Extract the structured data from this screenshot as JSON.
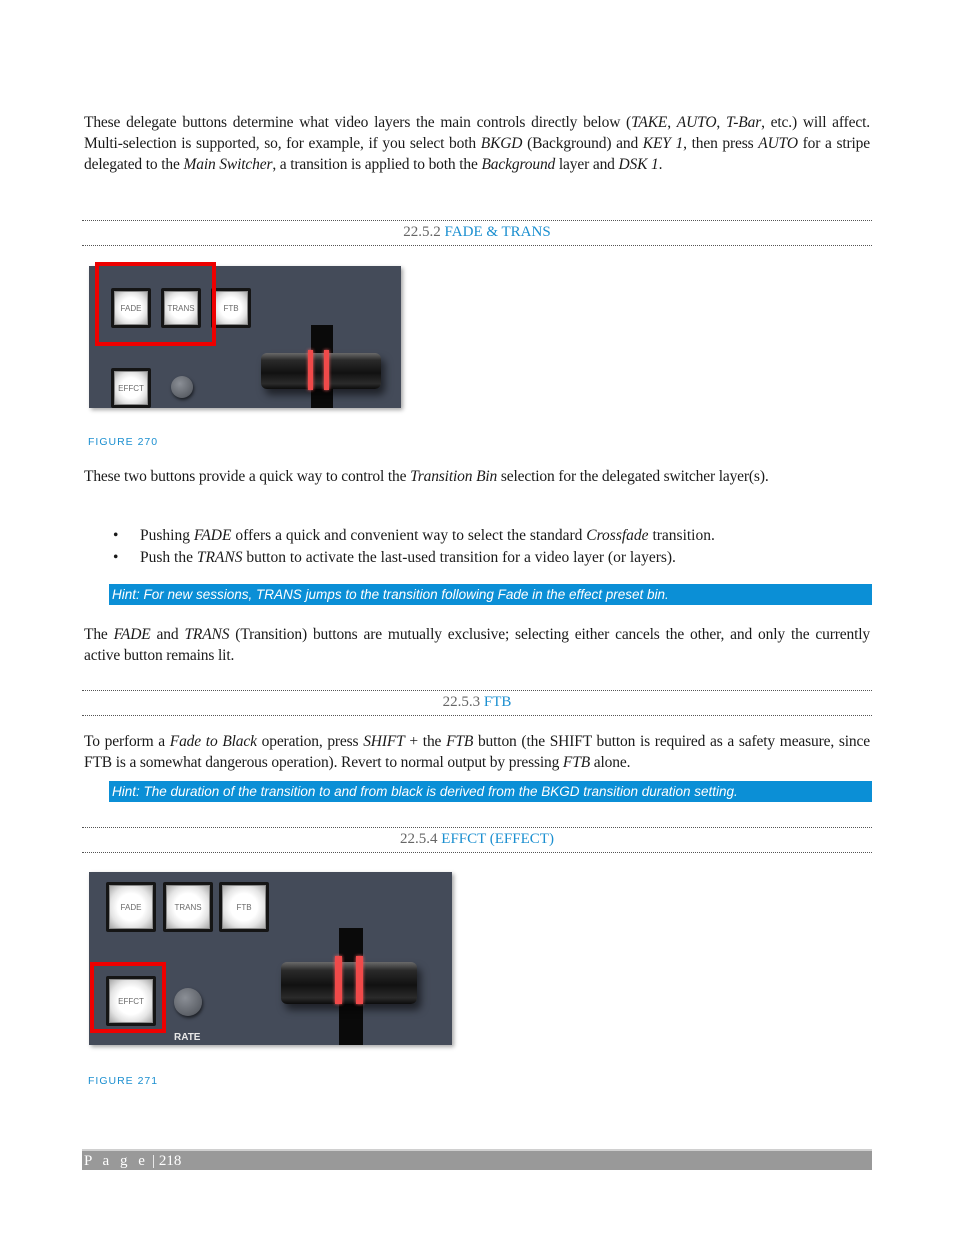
{
  "intro": {
    "segments": [
      {
        "t": "These delegate buttons determine what video layers the main controls directly below ("
      },
      {
        "t": "TAKE",
        "i": true
      },
      {
        "t": ", "
      },
      {
        "t": "AUTO",
        "i": true
      },
      {
        "t": ", "
      },
      {
        "t": "T-Bar",
        "i": true
      },
      {
        "t": ", etc.) will affect.  Multi-selection is supported, so, for example, if you select both "
      },
      {
        "t": "BKGD",
        "i": true
      },
      {
        "t": " (Background) and "
      },
      {
        "t": "KEY 1",
        "i": true
      },
      {
        "t": ", then press "
      },
      {
        "t": "AUTO",
        "i": true
      },
      {
        "t": " for a stripe delegated to the "
      },
      {
        "t": "Main Switcher",
        "i": true
      },
      {
        "t": ", a transition is applied to both the "
      },
      {
        "t": "Background",
        "i": true
      },
      {
        "t": " layer and "
      },
      {
        "t": "DSK 1",
        "i": true
      },
      {
        "t": "."
      }
    ]
  },
  "sections": {
    "fade_trans": {
      "number": "22.5.2",
      "title": "FADE & TRANS"
    },
    "ftb": {
      "number": "22.5.3",
      "title": "FTB"
    },
    "effct": {
      "number": "22.5.4",
      "title": "EFFCT (EFFECT)"
    }
  },
  "figure270": {
    "caption": "FIGURE 270",
    "buttons": {
      "fade": "FADE",
      "trans": "TRANS",
      "ftb": "FTB",
      "effct": "EFFCT"
    }
  },
  "para_two_buttons": {
    "segments": [
      {
        "t": "These two buttons provide a quick way to control the "
      },
      {
        "t": "Transition Bin",
        "i": true
      },
      {
        "t": " selection for the delegated switcher layer(s)."
      }
    ]
  },
  "bullets": [
    {
      "segments": [
        {
          "t": "Pushing "
        },
        {
          "t": "FADE",
          "i": true
        },
        {
          "t": " offers a quick and convenient way to select the standard "
        },
        {
          "t": "Crossfade",
          "i": true
        },
        {
          "t": " transition."
        }
      ]
    },
    {
      "segments": [
        {
          "t": "Push the "
        },
        {
          "t": "TRANS",
          "i": true
        },
        {
          "t": " button to activate the last-used transition for a video layer (or layers)."
        }
      ]
    }
  ],
  "bullet_glyph": "•",
  "hint1": "Hint: For new sessions, TRANS jumps to the transition following Fade in the effect preset bin.",
  "para_exclusive": {
    "segments": [
      {
        "t": "The "
      },
      {
        "t": "FADE",
        "i": true
      },
      {
        "t": " and "
      },
      {
        "t": "TRANS",
        "i": true
      },
      {
        "t": " (Transition) buttons are mutually exclusive; selecting either cancels the other, and only the currently active button remains lit."
      }
    ]
  },
  "para_ftb": {
    "segments": [
      {
        "t": "To perform a "
      },
      {
        "t": "Fade to Black",
        "i": true
      },
      {
        "t": " operation, press "
      },
      {
        "t": "SHIFT",
        "i": true
      },
      {
        "t": " + the "
      },
      {
        "t": "FTB",
        "i": true
      },
      {
        "t": " button (the SHIFT button is required as a safety measure, since FTB is a somewhat dangerous operation). Revert to normal output by pressing "
      },
      {
        "t": "FTB",
        "i": true
      },
      {
        "t": " alone."
      }
    ]
  },
  "hint2": "Hint: The duration of the transition to and from black is derived from the BKGD transition duration setting.",
  "figure271": {
    "caption": "FIGURE 271",
    "buttons": {
      "fade": "FADE",
      "trans": "TRANS",
      "ftb": "FTB",
      "effct": "EFFCT"
    },
    "knob_label": "RATE"
  },
  "footer": {
    "page_label": "P a g e",
    "separator": "|",
    "page_number": "218"
  },
  "colors": {
    "accent": "#1b8fd0",
    "hint_bg": "#0b8fd6",
    "highlight_box": "#ee0000",
    "panel": "#444b59",
    "footer_bg": "#999999"
  }
}
